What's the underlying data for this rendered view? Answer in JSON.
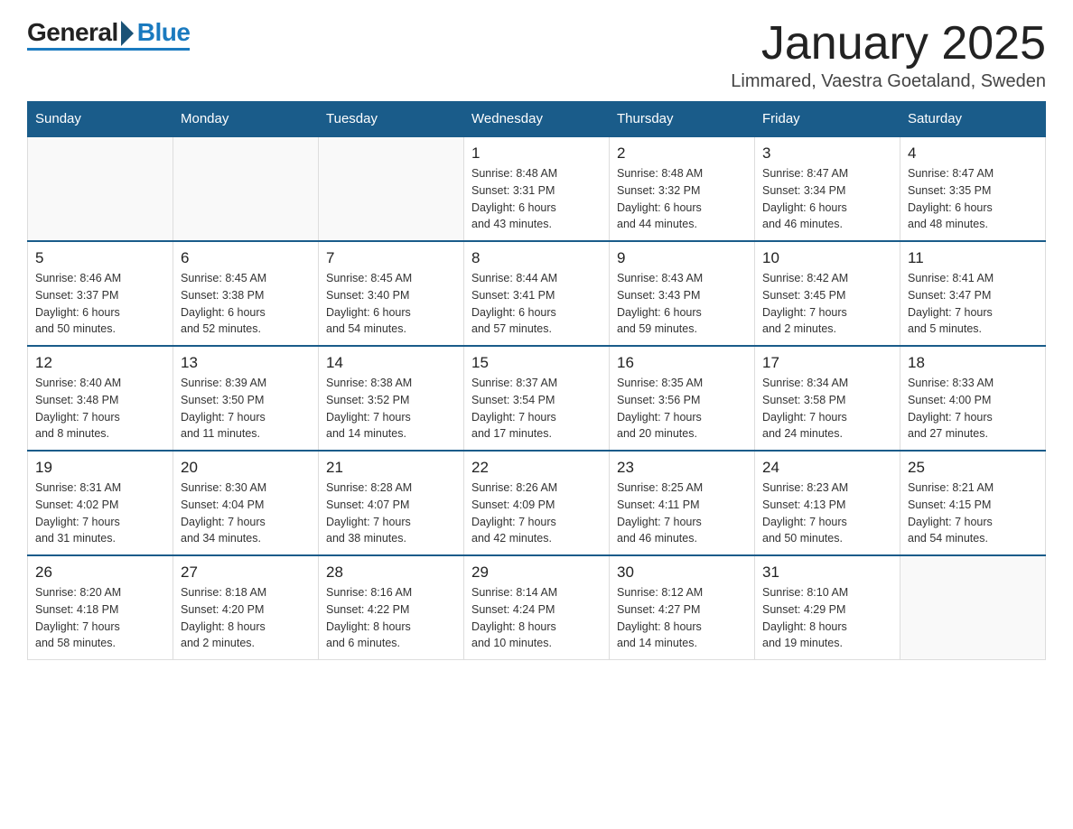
{
  "header": {
    "logo": {
      "general": "General",
      "blue": "Blue"
    },
    "title": "January 2025",
    "location": "Limmared, Vaestra Goetaland, Sweden"
  },
  "days_of_week": [
    "Sunday",
    "Monday",
    "Tuesday",
    "Wednesday",
    "Thursday",
    "Friday",
    "Saturday"
  ],
  "weeks": [
    [
      {
        "day": "",
        "info": ""
      },
      {
        "day": "",
        "info": ""
      },
      {
        "day": "",
        "info": ""
      },
      {
        "day": "1",
        "info": "Sunrise: 8:48 AM\nSunset: 3:31 PM\nDaylight: 6 hours\nand 43 minutes."
      },
      {
        "day": "2",
        "info": "Sunrise: 8:48 AM\nSunset: 3:32 PM\nDaylight: 6 hours\nand 44 minutes."
      },
      {
        "day": "3",
        "info": "Sunrise: 8:47 AM\nSunset: 3:34 PM\nDaylight: 6 hours\nand 46 minutes."
      },
      {
        "day": "4",
        "info": "Sunrise: 8:47 AM\nSunset: 3:35 PM\nDaylight: 6 hours\nand 48 minutes."
      }
    ],
    [
      {
        "day": "5",
        "info": "Sunrise: 8:46 AM\nSunset: 3:37 PM\nDaylight: 6 hours\nand 50 minutes."
      },
      {
        "day": "6",
        "info": "Sunrise: 8:45 AM\nSunset: 3:38 PM\nDaylight: 6 hours\nand 52 minutes."
      },
      {
        "day": "7",
        "info": "Sunrise: 8:45 AM\nSunset: 3:40 PM\nDaylight: 6 hours\nand 54 minutes."
      },
      {
        "day": "8",
        "info": "Sunrise: 8:44 AM\nSunset: 3:41 PM\nDaylight: 6 hours\nand 57 minutes."
      },
      {
        "day": "9",
        "info": "Sunrise: 8:43 AM\nSunset: 3:43 PM\nDaylight: 6 hours\nand 59 minutes."
      },
      {
        "day": "10",
        "info": "Sunrise: 8:42 AM\nSunset: 3:45 PM\nDaylight: 7 hours\nand 2 minutes."
      },
      {
        "day": "11",
        "info": "Sunrise: 8:41 AM\nSunset: 3:47 PM\nDaylight: 7 hours\nand 5 minutes."
      }
    ],
    [
      {
        "day": "12",
        "info": "Sunrise: 8:40 AM\nSunset: 3:48 PM\nDaylight: 7 hours\nand 8 minutes."
      },
      {
        "day": "13",
        "info": "Sunrise: 8:39 AM\nSunset: 3:50 PM\nDaylight: 7 hours\nand 11 minutes."
      },
      {
        "day": "14",
        "info": "Sunrise: 8:38 AM\nSunset: 3:52 PM\nDaylight: 7 hours\nand 14 minutes."
      },
      {
        "day": "15",
        "info": "Sunrise: 8:37 AM\nSunset: 3:54 PM\nDaylight: 7 hours\nand 17 minutes."
      },
      {
        "day": "16",
        "info": "Sunrise: 8:35 AM\nSunset: 3:56 PM\nDaylight: 7 hours\nand 20 minutes."
      },
      {
        "day": "17",
        "info": "Sunrise: 8:34 AM\nSunset: 3:58 PM\nDaylight: 7 hours\nand 24 minutes."
      },
      {
        "day": "18",
        "info": "Sunrise: 8:33 AM\nSunset: 4:00 PM\nDaylight: 7 hours\nand 27 minutes."
      }
    ],
    [
      {
        "day": "19",
        "info": "Sunrise: 8:31 AM\nSunset: 4:02 PM\nDaylight: 7 hours\nand 31 minutes."
      },
      {
        "day": "20",
        "info": "Sunrise: 8:30 AM\nSunset: 4:04 PM\nDaylight: 7 hours\nand 34 minutes."
      },
      {
        "day": "21",
        "info": "Sunrise: 8:28 AM\nSunset: 4:07 PM\nDaylight: 7 hours\nand 38 minutes."
      },
      {
        "day": "22",
        "info": "Sunrise: 8:26 AM\nSunset: 4:09 PM\nDaylight: 7 hours\nand 42 minutes."
      },
      {
        "day": "23",
        "info": "Sunrise: 8:25 AM\nSunset: 4:11 PM\nDaylight: 7 hours\nand 46 minutes."
      },
      {
        "day": "24",
        "info": "Sunrise: 8:23 AM\nSunset: 4:13 PM\nDaylight: 7 hours\nand 50 minutes."
      },
      {
        "day": "25",
        "info": "Sunrise: 8:21 AM\nSunset: 4:15 PM\nDaylight: 7 hours\nand 54 minutes."
      }
    ],
    [
      {
        "day": "26",
        "info": "Sunrise: 8:20 AM\nSunset: 4:18 PM\nDaylight: 7 hours\nand 58 minutes."
      },
      {
        "day": "27",
        "info": "Sunrise: 8:18 AM\nSunset: 4:20 PM\nDaylight: 8 hours\nand 2 minutes."
      },
      {
        "day": "28",
        "info": "Sunrise: 8:16 AM\nSunset: 4:22 PM\nDaylight: 8 hours\nand 6 minutes."
      },
      {
        "day": "29",
        "info": "Sunrise: 8:14 AM\nSunset: 4:24 PM\nDaylight: 8 hours\nand 10 minutes."
      },
      {
        "day": "30",
        "info": "Sunrise: 8:12 AM\nSunset: 4:27 PM\nDaylight: 8 hours\nand 14 minutes."
      },
      {
        "day": "31",
        "info": "Sunrise: 8:10 AM\nSunset: 4:29 PM\nDaylight: 8 hours\nand 19 minutes."
      },
      {
        "day": "",
        "info": ""
      }
    ]
  ]
}
